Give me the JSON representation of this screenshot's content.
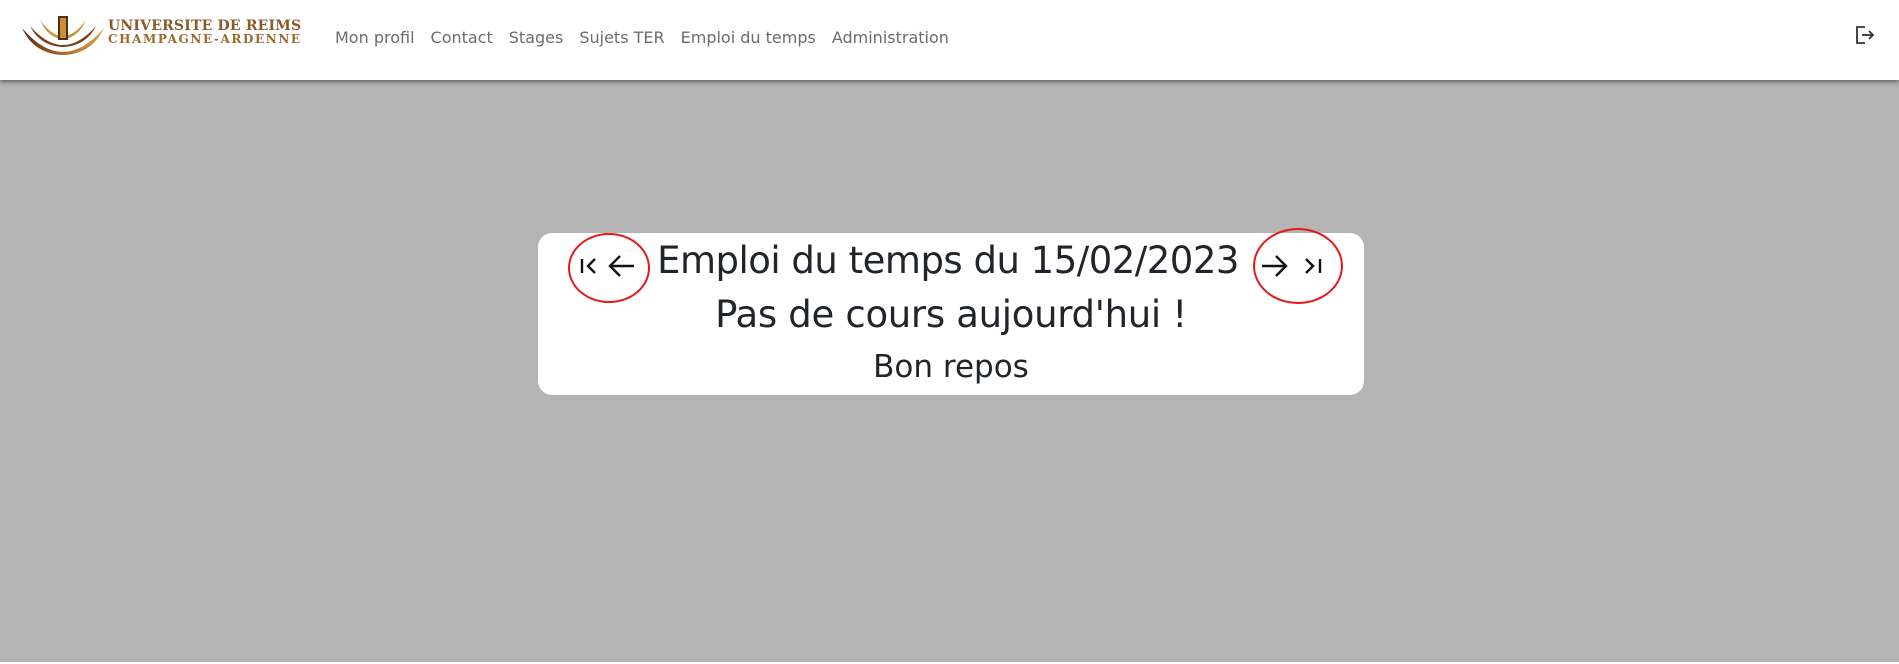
{
  "brand": {
    "line1": "UNIVERSITE DE REIMS",
    "line2": "CHAMPAGNE-ARDENNE",
    "emblem_icon": "university-emblem-icon",
    "colors": {
      "dark": "#5a2a14",
      "gold": "#c8923a"
    }
  },
  "nav": {
    "items": [
      {
        "label": "Mon profil"
      },
      {
        "label": "Contact"
      },
      {
        "label": "Stages"
      },
      {
        "label": "Sujets TER"
      },
      {
        "label": "Emploi du temps"
      },
      {
        "label": "Administration"
      }
    ],
    "logout_icon": "logout-icon"
  },
  "schedule": {
    "title": "Emploi du temps du 15/02/2023",
    "message": "Pas de cours aujourd'hui !",
    "submessage": "Bon repos",
    "first_icon": "first-page-icon",
    "prev_icon": "arrow-left-icon",
    "next_icon": "arrow-right-icon",
    "last_icon": "last-page-icon",
    "highlight_color": "#e41a1a"
  },
  "colors": {
    "background": "#b4b4b4",
    "card": "#ffffff",
    "text": "#212529",
    "nav_text": "#6c6c6c"
  }
}
